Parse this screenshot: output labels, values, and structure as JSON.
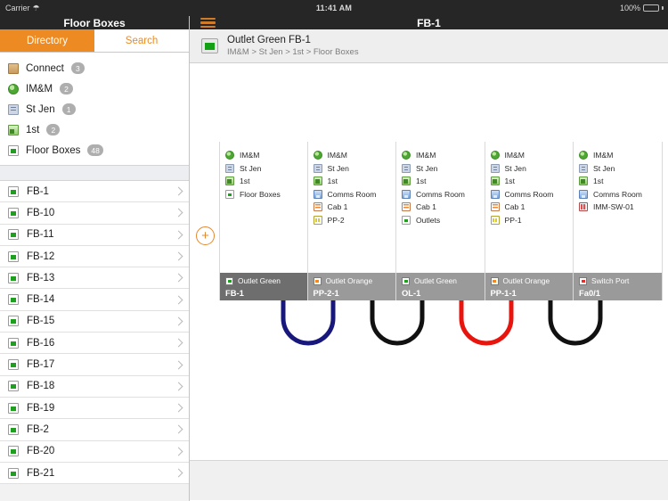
{
  "status_bar": {
    "carrier": "Carrier",
    "wifi_icon": "wifi-icon",
    "time": "11:41 AM",
    "battery_percent": "100%"
  },
  "left_panel": {
    "title": "Floor Boxes",
    "tabs": [
      {
        "label": "Directory",
        "active": true
      },
      {
        "label": "Search",
        "active": false
      }
    ],
    "breadcrumb_items": [
      {
        "label": "Connect",
        "badge": "3",
        "icon": "box-icon",
        "icon_class": "ico-box"
      },
      {
        "label": "IM&M",
        "badge": "2",
        "icon": "globe-icon",
        "icon_class": "ico-globe"
      },
      {
        "label": "St Jen",
        "badge": "1",
        "icon": "building-icon",
        "icon_class": "ico-building"
      },
      {
        "label": "1st",
        "badge": "2",
        "icon": "floor-icon",
        "icon_class": "ico-floor"
      },
      {
        "label": "Floor Boxes",
        "badge": "48",
        "icon": "green-outlet-icon",
        "icon_class": "ico-green"
      }
    ],
    "list_items": [
      {
        "label": "FB-1",
        "icon": "green-outlet-icon"
      },
      {
        "label": "FB-10",
        "icon": "green-outlet-icon"
      },
      {
        "label": "FB-11",
        "icon": "green-outlet-icon"
      },
      {
        "label": "FB-12",
        "icon": "green-outlet-icon"
      },
      {
        "label": "FB-13",
        "icon": "green-outlet-icon"
      },
      {
        "label": "FB-14",
        "icon": "green-outlet-icon"
      },
      {
        "label": "FB-15",
        "icon": "green-outlet-icon"
      },
      {
        "label": "FB-16",
        "icon": "green-outlet-icon"
      },
      {
        "label": "FB-17",
        "icon": "green-outlet-icon"
      },
      {
        "label": "FB-18",
        "icon": "green-outlet-icon"
      },
      {
        "label": "FB-19",
        "icon": "green-outlet-icon"
      },
      {
        "label": "FB-2",
        "icon": "green-outlet-icon"
      },
      {
        "label": "FB-20",
        "icon": "green-outlet-icon"
      },
      {
        "label": "FB-21",
        "icon": "green-outlet-icon"
      }
    ]
  },
  "main_panel": {
    "menu_icon": "hamburger-icon",
    "title": "FB-1",
    "header": {
      "icon": "green-outlet-icon",
      "title": "Outlet Green FB-1",
      "breadcrumb": "IM&M > St Jen > 1st > Floor Boxes"
    },
    "add_button_label": "+",
    "cards": [
      {
        "selected": true,
        "path": [
          {
            "label": "IM&M",
            "icon_class": "ico-globe",
            "icon": "globe-icon"
          },
          {
            "label": "St Jen",
            "icon_class": "ico-building",
            "icon": "building-icon"
          },
          {
            "label": "1st",
            "icon_class": "ico-floor",
            "icon": "floor-icon"
          },
          {
            "label": "Floor Boxes",
            "icon_class": "ico-green",
            "icon": "green-outlet-icon"
          }
        ],
        "footer_type": "Outlet Green",
        "footer_name": "FB-1",
        "footer_icon_class": "green"
      },
      {
        "selected": false,
        "path": [
          {
            "label": "IM&M",
            "icon_class": "ico-globe",
            "icon": "globe-icon"
          },
          {
            "label": "St Jen",
            "icon_class": "ico-building",
            "icon": "building-icon"
          },
          {
            "label": "1st",
            "icon_class": "ico-floor",
            "icon": "floor-icon"
          },
          {
            "label": "Comms Room",
            "icon_class": "ico-comms",
            "icon": "comms-room-icon"
          },
          {
            "label": "Cab 1",
            "icon_class": "ico-cab",
            "icon": "cabinet-icon"
          },
          {
            "label": "PP-2",
            "icon_class": "ico-pp",
            "icon": "patch-panel-icon"
          }
        ],
        "footer_type": "Outlet Orange",
        "footer_name": "PP-2-1",
        "footer_icon_class": "orange"
      },
      {
        "selected": false,
        "path": [
          {
            "label": "IM&M",
            "icon_class": "ico-globe",
            "icon": "globe-icon"
          },
          {
            "label": "St Jen",
            "icon_class": "ico-building",
            "icon": "building-icon"
          },
          {
            "label": "1st",
            "icon_class": "ico-floor",
            "icon": "floor-icon"
          },
          {
            "label": "Comms Room",
            "icon_class": "ico-comms",
            "icon": "comms-room-icon"
          },
          {
            "label": "Cab 1",
            "icon_class": "ico-cab",
            "icon": "cabinet-icon"
          },
          {
            "label": "Outlets",
            "icon_class": "ico-green",
            "icon": "green-outlet-icon"
          }
        ],
        "footer_type": "Outlet Green",
        "footer_name": "OL-1",
        "footer_icon_class": "green"
      },
      {
        "selected": false,
        "path": [
          {
            "label": "IM&M",
            "icon_class": "ico-globe",
            "icon": "globe-icon"
          },
          {
            "label": "St Jen",
            "icon_class": "ico-building",
            "icon": "building-icon"
          },
          {
            "label": "1st",
            "icon_class": "ico-floor",
            "icon": "floor-icon"
          },
          {
            "label": "Comms Room",
            "icon_class": "ico-comms",
            "icon": "comms-room-icon"
          },
          {
            "label": "Cab 1",
            "icon_class": "ico-cab",
            "icon": "cabinet-icon"
          },
          {
            "label": "PP-1",
            "icon_class": "ico-pp",
            "icon": "patch-panel-icon"
          }
        ],
        "footer_type": "Outlet Orange",
        "footer_name": "PP-1-1",
        "footer_icon_class": "orange"
      },
      {
        "selected": false,
        "path": [
          {
            "label": "IM&M",
            "icon_class": "ico-globe",
            "icon": "globe-icon"
          },
          {
            "label": "St Jen",
            "icon_class": "ico-building",
            "icon": "building-icon"
          },
          {
            "label": "1st",
            "icon_class": "ico-floor",
            "icon": "floor-icon"
          },
          {
            "label": "Comms Room",
            "icon_class": "ico-comms",
            "icon": "comms-room-icon"
          },
          {
            "label": "IMM-SW-01",
            "icon_class": "ico-switch",
            "icon": "switch-icon"
          }
        ],
        "footer_type": "Switch Port",
        "footer_name": "Fa0/1",
        "footer_icon_class": "red"
      }
    ],
    "cable_links": [
      {
        "from_card": 0,
        "to_card": 1,
        "color": "#17177c"
      },
      {
        "from_card": 1,
        "to_card": 2,
        "color": "#111111"
      },
      {
        "from_card": 2,
        "to_card": 3,
        "color": "#e8150f"
      },
      {
        "from_card": 3,
        "to_card": 4,
        "color": "#111111"
      }
    ]
  },
  "colors": {
    "accent": "#ed8b22",
    "nav_bar": "#262626",
    "card_footer": "#9a9a9a",
    "card_footer_selected": "#6e6e6e"
  }
}
